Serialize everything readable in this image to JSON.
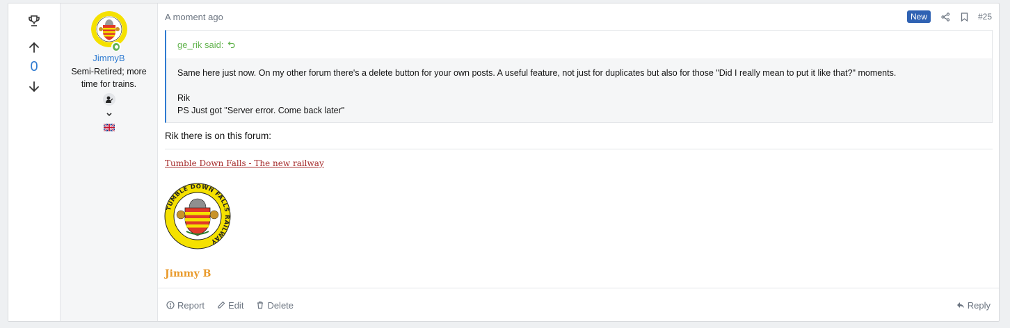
{
  "votes": {
    "score": "0",
    "icons": [
      "trophy-icon",
      "upvote-arrow-icon",
      "downvote-arrow-icon"
    ]
  },
  "user": {
    "name": "JimmyB",
    "title": "Semi-Retired; more time for trains.",
    "status": "online",
    "flag": "uk-flag"
  },
  "post": {
    "time": "A moment ago",
    "badge": "New",
    "number": "#25",
    "quote": {
      "author": "ge_rik said:",
      "line1": "Same here just now. On my other forum there's a delete button for your own posts. A useful feature, not just for duplicates but also for those \"Did I really mean to put it like that?\" moments.",
      "line2": "Rik",
      "line3": "PS Just got \"Server error. Come back later\""
    },
    "body": "Rik there is on this forum:",
    "signature": {
      "link": "Tumble Down Falls - The new railway",
      "logo_text": "TUMBLE DOWN FALLS RAILWAY",
      "name": "Jimmy B"
    }
  },
  "footer": {
    "report": "Report",
    "edit": "Edit",
    "delete": "Delete",
    "reply": "Reply"
  },
  "colors": {
    "link": "#2f7bd1",
    "badge": "#2f62b3",
    "quote_author": "#64b450",
    "signature_name": "#e99a2b",
    "signature_link": "#a52a2a"
  }
}
